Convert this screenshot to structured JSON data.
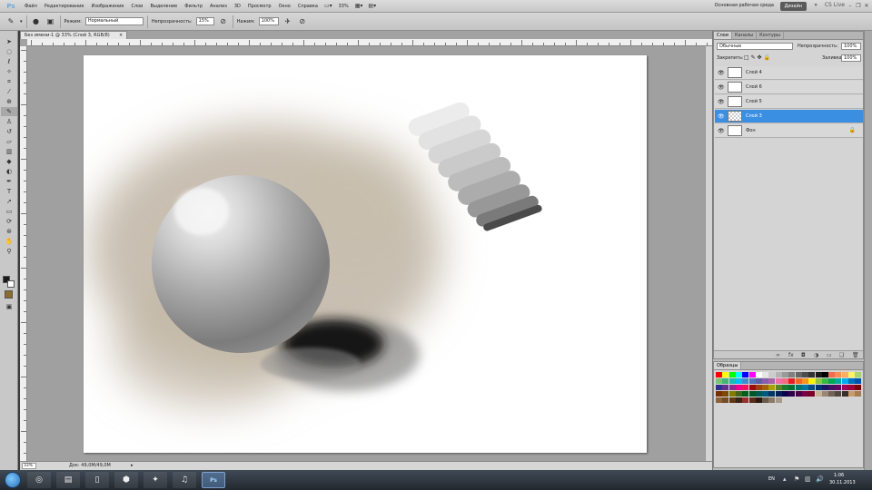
{
  "menubar": {
    "logo": "Ps",
    "items": [
      "Файл",
      "Редактирование",
      "Изображение",
      "Слои",
      "Выделение",
      "Фильтр",
      "Анализ",
      "3D",
      "Просмотр",
      "Окно",
      "Справка"
    ],
    "workspace_label": "Основная рабочая среда",
    "design_label": "Дизайн",
    "cs_live": "CS Live",
    "zoom_value": "33%"
  },
  "options": {
    "mode_label": "Режим:",
    "mode_value": "Нормальный",
    "opacity_label": "Непрозрачность:",
    "opacity_value": "15%",
    "flow_label": "Нажим:",
    "flow_value": "100%"
  },
  "tools": [
    "move-icon",
    "marquee-icon",
    "lasso-icon",
    "quick-select-icon",
    "crop-icon",
    "eyedropper-icon",
    "healing-icon",
    "brush-icon",
    "stamp-icon",
    "history-brush-icon",
    "eraser-icon",
    "gradient-icon",
    "blur-icon",
    "dodge-icon",
    "pen-icon",
    "type-icon",
    "path-select-icon",
    "shape-icon",
    "3d-rotate-icon",
    "3d-orbit-icon",
    "hand-icon",
    "zoom-icon"
  ],
  "colors": {
    "foreground": "#1a1a1a",
    "background": "#ffffff",
    "accent": "#3b8fe3",
    "quickmask": "#8a6d2b"
  },
  "document": {
    "tab_title": "Без имени-1 @ 33% (Слой 3, RGB/8)",
    "close": "×",
    "zoom": "33%",
    "info": "Док: 49,0M/49,0M",
    "arrow": "▸"
  },
  "layers_panel": {
    "tabs": [
      "Слои",
      "Каналы",
      "Контуры"
    ],
    "blend_mode": "Обычные",
    "opacity_label": "Непрозрачность:",
    "opacity_value": "100%",
    "lock_label": "Закрепить:",
    "fill_label": "Заливка:",
    "fill_value": "100%",
    "layers": [
      {
        "name": "Слой 4",
        "selected": false
      },
      {
        "name": "Слой 6",
        "selected": false
      },
      {
        "name": "Слой 5",
        "selected": false
      },
      {
        "name": "Слой 3",
        "selected": true
      },
      {
        "name": "Фон",
        "selected": false
      }
    ]
  },
  "swatches_panel": {
    "title": "Образцы"
  },
  "taskbar": {
    "lang": "EN",
    "time": "1:06",
    "date": "30.11.2013",
    "apps": [
      "chrome-icon",
      "folder-icon",
      "document-icon",
      "antivirus-icon",
      "app-icon",
      "speaker-icon",
      "photoshop-icon"
    ],
    "ps_label": "Ps"
  }
}
